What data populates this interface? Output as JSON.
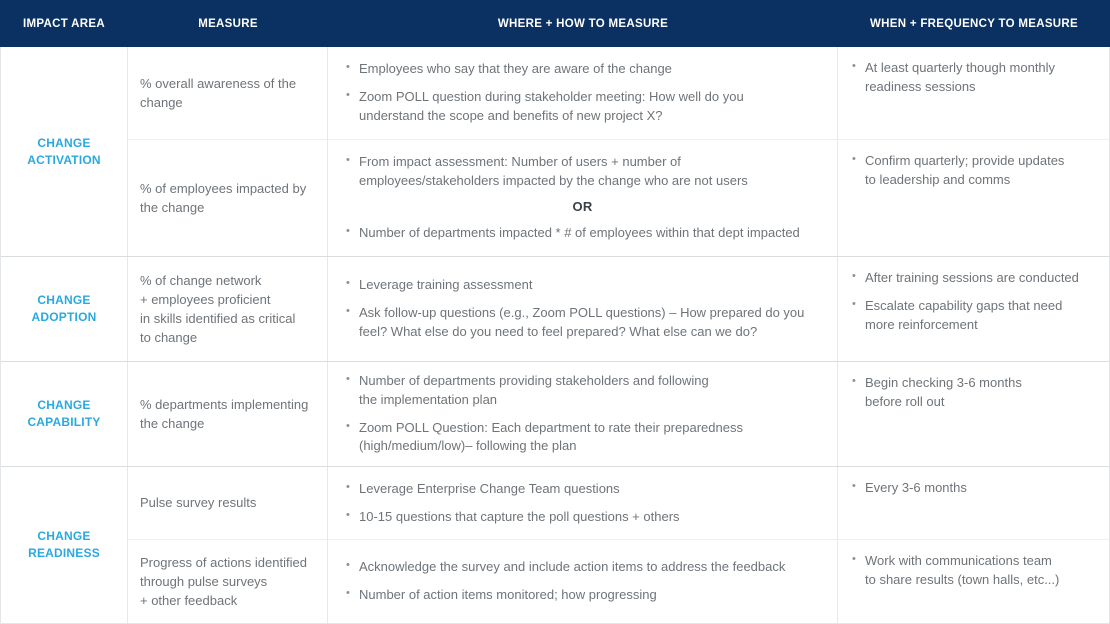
{
  "header": {
    "columns": [
      {
        "label": "IMPACT AREA"
      },
      {
        "label": "MEASURE"
      },
      {
        "label": "WHERE + HOW TO MEASURE"
      },
      {
        "label": "WHEN + FREQUENCY TO MEASURE"
      }
    ]
  },
  "colors": {
    "header_background": "#0A3161",
    "header_text": "#FFFFFF",
    "impact_label": "#2AA9E0",
    "body_text": "#6E7479",
    "border": "#E6E9EB",
    "row_divider": "#D9DDE0",
    "or_text": "#3B4045"
  },
  "rows": [
    {
      "impact_area": "CHANGE\nACTIVATION",
      "subrows": [
        {
          "measure": "% overall awareness of the\nchange",
          "where": [
            "Employees who say that they are aware of the change",
            "Zoom POLL question during stakeholder meeting: How well do you\nunderstand the scope and benefits of new project X?"
          ],
          "or_separator": null,
          "where_after_or": [],
          "when": [
            "At least quarterly though monthly\nreadiness sessions"
          ]
        },
        {
          "measure": "% of employees impacted by\nthe change",
          "where": [
            "From impact assessment: Number of users + number of\nemployees/stakeholders impacted by the change who are not users"
          ],
          "or_separator": "OR",
          "where_after_or": [
            "Number of departments impacted * # of employees within that dept impacted"
          ],
          "when": [
            "Confirm quarterly; provide updates\nto leadership and comms"
          ]
        }
      ]
    },
    {
      "impact_area": "CHANGE\nADOPTION",
      "subrows": [
        {
          "measure": "% of change network\n+ employees proficient\nin skills identified as critical\nto change",
          "where": [
            "Leverage training assessment",
            "Ask follow-up questions (e.g., Zoom POLL questions) – How prepared do you\nfeel?  What else do you need to feel prepared?  What else can we do?"
          ],
          "or_separator": null,
          "where_after_or": [],
          "when": [
            "After training sessions are conducted",
            "Escalate capability gaps that need\nmore reinforcement"
          ]
        }
      ]
    },
    {
      "impact_area": "CHANGE\nCAPABILITY",
      "subrows": [
        {
          "measure": "% departments implementing\nthe change",
          "where": [
            "Number of departments providing stakeholders and following\nthe implementation plan",
            "Zoom POLL Question: Each department to rate their preparedness\n(high/medium/low)– following the plan"
          ],
          "or_separator": null,
          "where_after_or": [],
          "when": [
            "Begin checking 3-6 months\nbefore roll out"
          ]
        }
      ]
    },
    {
      "impact_area": "CHANGE\nREADINESS",
      "subrows": [
        {
          "measure": "Pulse survey results",
          "where": [
            "Leverage Enterprise Change Team questions",
            "10-15 questions that capture the poll questions + others"
          ],
          "or_separator": null,
          "where_after_or": [],
          "when": [
            "Every 3-6 months"
          ]
        },
        {
          "measure": "Progress of actions identified\nthrough pulse surveys\n+ other feedback",
          "where": [
            "Acknowledge the survey and include action items to address the feedback",
            "Number of action items monitored; how progressing"
          ],
          "or_separator": null,
          "where_after_or": [],
          "when": [
            "Work with communications team\nto share results (town halls, etc...)"
          ]
        }
      ]
    }
  ]
}
